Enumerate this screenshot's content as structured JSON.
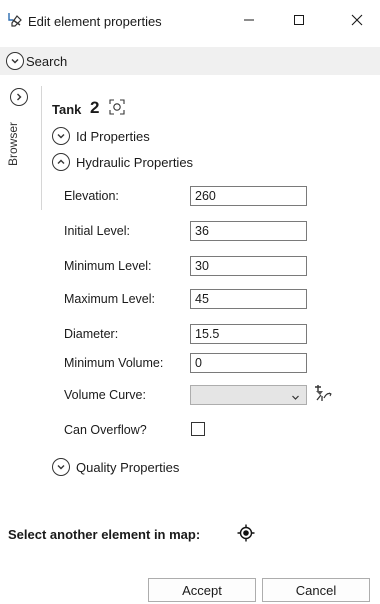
{
  "window": {
    "title": "Edit element properties",
    "icon": "element-edit-icon",
    "controls": [
      "minimize-icon",
      "maximize-icon",
      "close-icon"
    ]
  },
  "search": {
    "label": "Search"
  },
  "browser": {
    "label": "Browser"
  },
  "element": {
    "type_label": "Tank",
    "id": "2"
  },
  "sections": {
    "id": {
      "label": "Id Properties",
      "expanded": false
    },
    "hydraulic": {
      "label": "Hydraulic Properties",
      "expanded": true
    },
    "quality": {
      "label": "Quality Properties",
      "expanded": false
    }
  },
  "hydraulic": {
    "elevation": {
      "label": "Elevation:",
      "value": "260"
    },
    "initial_level": {
      "label": "Initial Level:",
      "value": "36"
    },
    "minimum_level": {
      "label": "Minimum Level:",
      "value": "30"
    },
    "maximum_level": {
      "label": "Maximum Level:",
      "value": "45"
    },
    "diameter": {
      "label": "Diameter:",
      "value": "15.5"
    },
    "minimum_volume": {
      "label": "Minimum Volume:",
      "value": "0"
    },
    "volume_curve": {
      "label": "Volume Curve:",
      "value": ""
    },
    "can_overflow": {
      "label": "Can Overflow?",
      "checked": false
    }
  },
  "select_another": {
    "label": "Select another element in map:"
  },
  "buttons": {
    "accept": "Accept",
    "cancel": "Cancel"
  }
}
